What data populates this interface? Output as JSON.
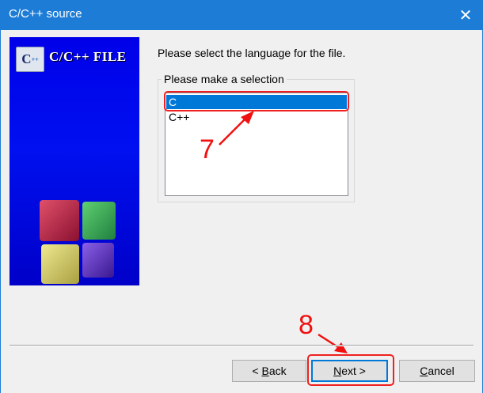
{
  "window": {
    "title": "C/C++ source",
    "close_glyph": "✕"
  },
  "banner": {
    "logo_text": "C/C++ FILE",
    "icon_letter": "C",
    "icon_sup": "++"
  },
  "instruction": "Please select the language for the file.",
  "selection_group": {
    "legend": "Please make a selection",
    "options": [
      {
        "label": "C",
        "selected": true
      },
      {
        "label": "C++",
        "selected": false
      }
    ]
  },
  "annotations": {
    "step_select": "7",
    "step_next": "8",
    "color": "#f01010"
  },
  "buttons": {
    "back": {
      "mnemonic": "B",
      "rest": "ack",
      "prefix": "< "
    },
    "next": {
      "mnemonic": "N",
      "rest": "ext >"
    },
    "cancel": {
      "mnemonic": "C",
      "rest": "ancel"
    }
  },
  "colors": {
    "titlebar": "#1d7dd6",
    "selection": "#0078d7",
    "banner": "#0000e8"
  }
}
